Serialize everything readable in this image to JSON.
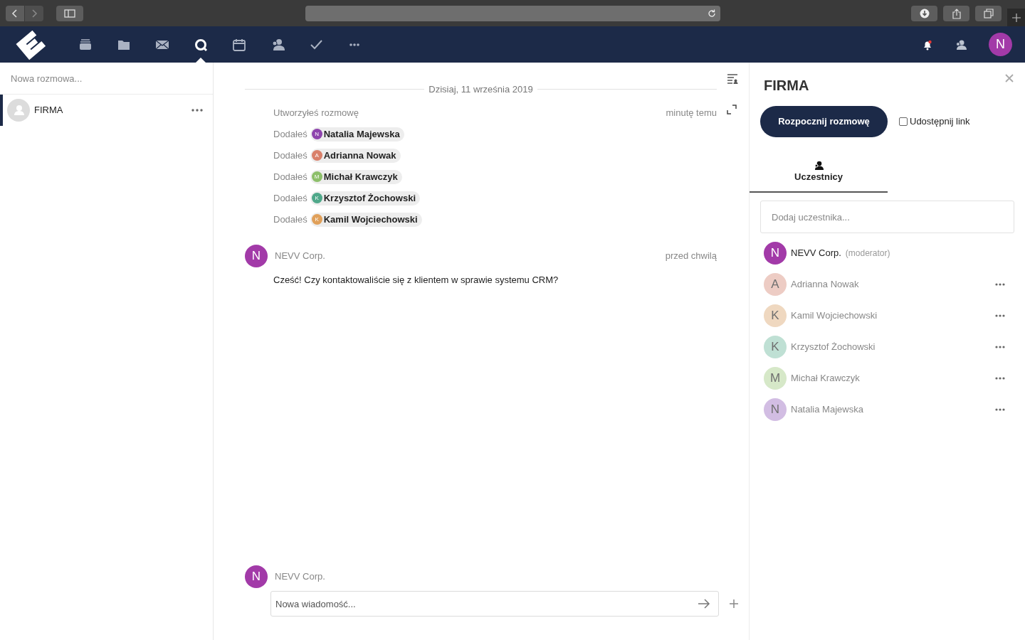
{
  "app_nav": {
    "items": [
      {
        "selected": false
      },
      {
        "selected": false
      },
      {
        "selected": false
      },
      {
        "selected": true
      },
      {
        "selected": false
      },
      {
        "selected": false
      },
      {
        "selected": false
      },
      {
        "selected": false
      }
    ],
    "user_avatar": "N"
  },
  "sidebar": {
    "search": {
      "placeholder": "Nowa rozmowa..."
    },
    "conversations": [
      {
        "name": "FIRMA",
        "selected": true
      }
    ]
  },
  "chat": {
    "date_separator": "Dzisiaj, 11 września 2019",
    "system_messages": [
      {
        "text": "Utworzyłeś rozmowę",
        "time": "minutę temu"
      },
      {
        "text": "Dodałeś",
        "mention": {
          "initial": "N",
          "name": "Natalia Majewska",
          "color": "#8e44ad"
        }
      },
      {
        "text": "Dodałeś",
        "mention": {
          "initial": "A",
          "name": "Adrianna Nowak",
          "color": "#d9806a"
        }
      },
      {
        "text": "Dodałeś",
        "mention": {
          "initial": "M",
          "name": "Michał Krawczyk",
          "color": "#8dbf6a"
        }
      },
      {
        "text": "Dodałeś",
        "mention": {
          "initial": "K",
          "name": "Krzysztof Żochowski",
          "color": "#4fa88a"
        }
      },
      {
        "text": "Dodałeś",
        "mention": {
          "initial": "K",
          "name": "Kamil Wojciechowski",
          "color": "#e0a05a"
        }
      }
    ],
    "messages": [
      {
        "initial": "N",
        "author": "NEVV Corp.",
        "time": "przed chwilą",
        "text": "Cześć! Czy kontaktowaliście się z klientem w sprawie systemu CRM?"
      }
    ],
    "composer": {
      "initial": "N",
      "author": "NEVV Corp.",
      "placeholder": "Nowa wiadomość..."
    }
  },
  "details": {
    "title": "FIRMA",
    "start_button": "Rozpocznij rozmowę",
    "share_link": {
      "label": "Udostępnij link",
      "checked": false
    },
    "tabs": [
      {
        "label": "Uczestnicy",
        "selected": true
      }
    ],
    "add_participant": {
      "placeholder": "Dodaj uczestnika..."
    },
    "participants": [
      {
        "initial": "N",
        "name": "NEVV Corp.",
        "role": "(moderator)",
        "color": "#a23aa8",
        "online": true
      },
      {
        "initial": "A",
        "name": "Adrianna Nowak",
        "color": "#edccc4",
        "online": false
      },
      {
        "initial": "K",
        "name": "Kamil Wojciechowski",
        "color": "#efd8c0",
        "online": false
      },
      {
        "initial": "K",
        "name": "Krzysztof Żochowski",
        "color": "#bfe0d4",
        "online": false
      },
      {
        "initial": "M",
        "name": "Michał Krawczyk",
        "color": "#d6e8c8",
        "online": false
      },
      {
        "initial": "N",
        "name": "Natalia Majewska",
        "color": "#d2bde3",
        "online": false
      }
    ]
  }
}
